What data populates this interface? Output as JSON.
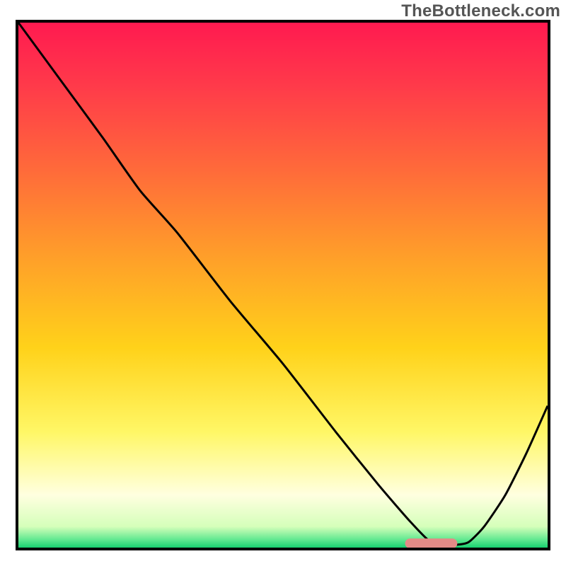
{
  "watermark": "TheBottleneck.com",
  "chart_data": {
    "type": "line",
    "title": "",
    "xlabel": "",
    "ylabel": "",
    "xlim": [
      0,
      100
    ],
    "ylim": [
      0,
      100
    ],
    "background_gradient": {
      "stops": [
        {
          "offset": 0.0,
          "color": "#ff1a50"
        },
        {
          "offset": 0.12,
          "color": "#ff3a4a"
        },
        {
          "offset": 0.28,
          "color": "#ff6a3a"
        },
        {
          "offset": 0.45,
          "color": "#ffa029"
        },
        {
          "offset": 0.62,
          "color": "#ffd21a"
        },
        {
          "offset": 0.78,
          "color": "#fff766"
        },
        {
          "offset": 0.9,
          "color": "#ffffe0"
        },
        {
          "offset": 0.96,
          "color": "#d5ffba"
        },
        {
          "offset": 0.985,
          "color": "#60e890"
        },
        {
          "offset": 1.0,
          "color": "#18d070"
        }
      ]
    },
    "series": [
      {
        "name": "curve",
        "color": "#000000",
        "x": [
          0,
          8,
          16,
          23,
          30,
          40,
          50,
          60,
          68,
          74,
          78,
          82,
          85,
          88,
          92,
          96,
          100
        ],
        "y": [
          100,
          89,
          78,
          68,
          60,
          47,
          35,
          22,
          12,
          5,
          1,
          0.5,
          1,
          4,
          10,
          18,
          27
        ]
      }
    ],
    "marker": {
      "name": "bottleneck-marker",
      "x_start": 74,
      "x_end": 82,
      "y": 0.8,
      "color": "#e48b87",
      "thickness": 2.8
    }
  }
}
